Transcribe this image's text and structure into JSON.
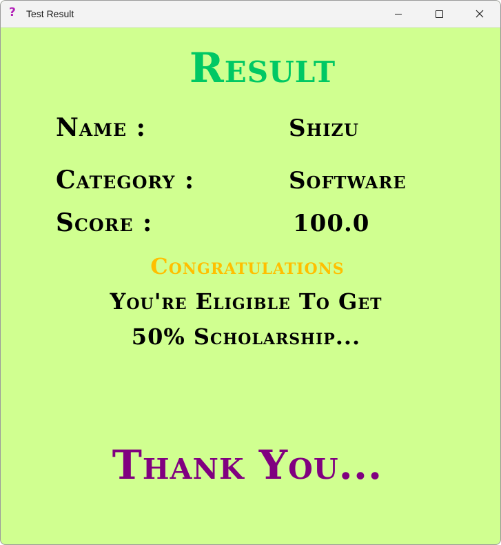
{
  "window": {
    "title": "Test Result",
    "app_icon": "?",
    "app_icon_color": "#b21fb8",
    "close_glyph": "✕"
  },
  "result": {
    "heading": "Result",
    "heading_color": "#00c864",
    "background_color": "#d0ff90",
    "name_label": "Name :",
    "name_value": "Shizu",
    "category_label": "Category :",
    "category_value": "Software",
    "score_label": "Score :",
    "score_value": "100.0",
    "congratulations": "Congratulations",
    "congratulations_color": "#ffbf00",
    "eligible_line1": "You're Eligible To Get",
    "eligible_line2": "50% Scholarship...",
    "thank_you": "Thank You...",
    "thank_you_color": "#800080"
  },
  "icons": {
    "app": "question-mark-icon",
    "minimize": "minimize-icon",
    "maximize": "maximize-icon",
    "close": "close-icon"
  }
}
